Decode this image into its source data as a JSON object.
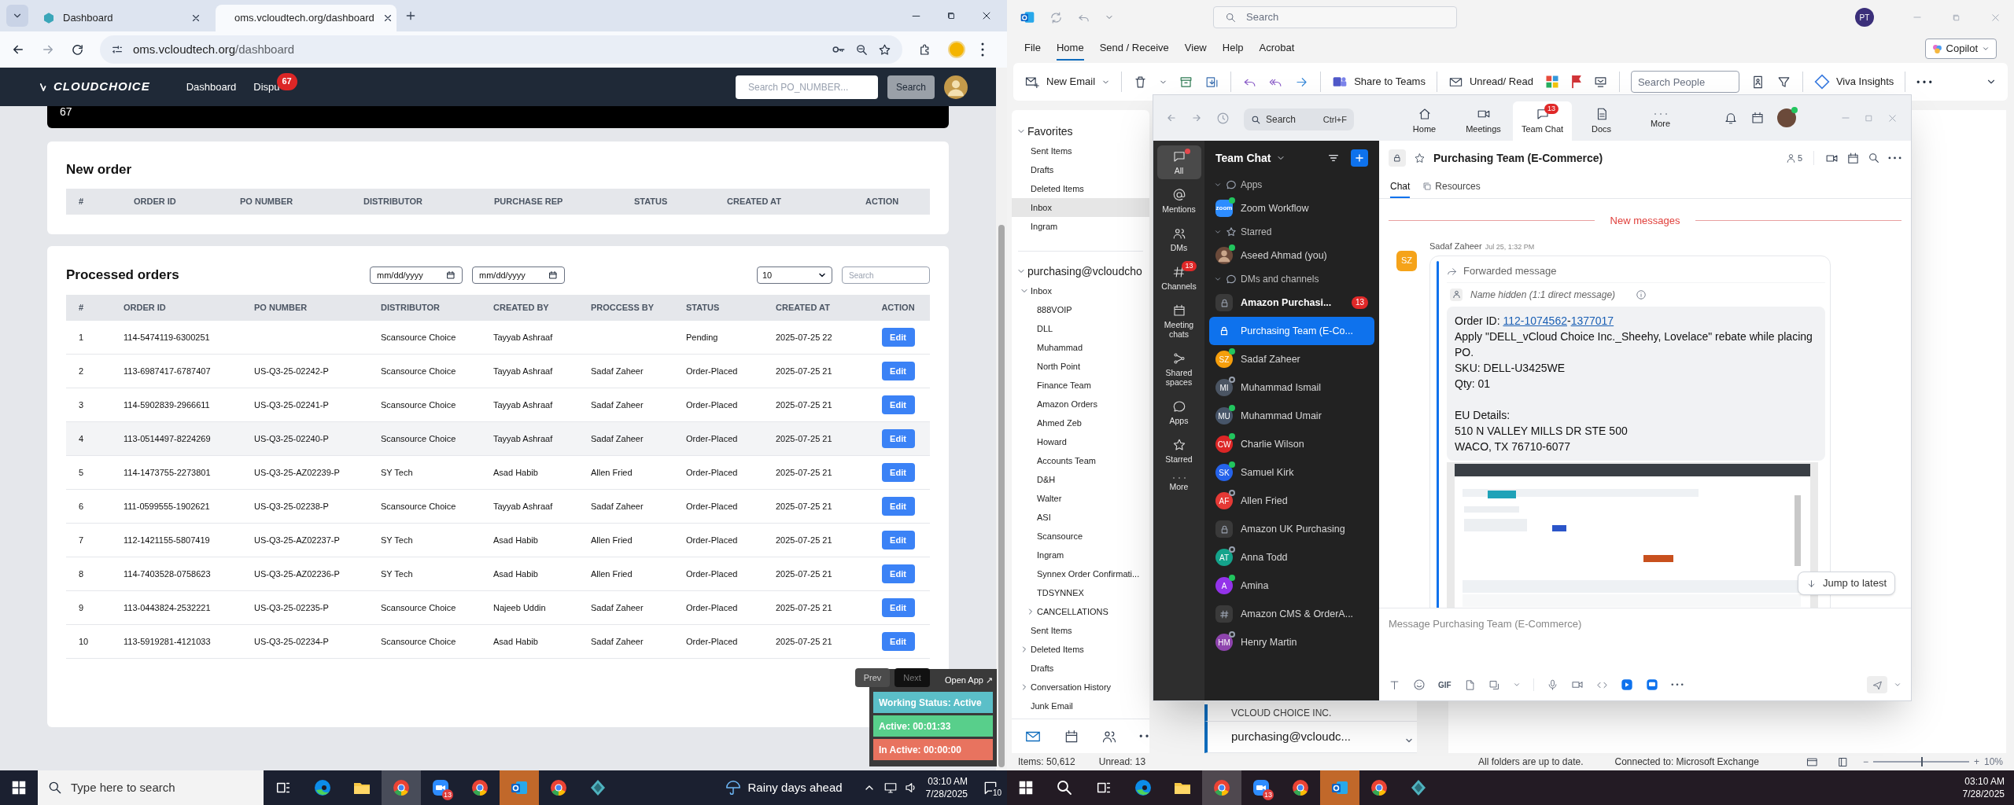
{
  "left_screen": {
    "browser": {
      "tabs": [
        {
          "label": "Dashboard",
          "selected": false
        },
        {
          "label": "oms.vcloudtech.org/dashboard",
          "selected": true
        }
      ],
      "url": {
        "host": "oms.vcloudtech.org",
        "path": "/dashboard"
      }
    },
    "app": {
      "logo": "CLOUDCHOICE",
      "nav": [
        {
          "label": "Dashboard"
        },
        {
          "label": "Dispu",
          "badge": "67"
        }
      ],
      "search": {
        "placeholder": "Search PO_NUMBER..."
      },
      "search_button": "Search",
      "banner_value": "67",
      "new_order": {
        "title": "New order",
        "columns": [
          "#",
          "ORDER ID",
          "PO NUMBER",
          "DISTRIBUTOR",
          "PURCHASE REP",
          "STATUS",
          "CREATED AT",
          "ACTION"
        ]
      },
      "processed_orders": {
        "title": "Processed orders",
        "date_from": {
          "placeholder": "mm/dd/yyyy"
        },
        "date_to": {
          "placeholder": "mm/dd/yyyy"
        },
        "page_size": "10",
        "search": {
          "placeholder": "Search"
        },
        "columns": [
          "#",
          "ORDER ID",
          "PO NUMBER",
          "DISTRIBUTOR",
          "CREATED BY",
          "PROCCESS BY",
          "STATUS",
          "CREATED AT",
          "ACTION"
        ],
        "rows": [
          {
            "num": "1",
            "order_id": "114-5474119-6300251",
            "distributor": "Scansource Choice",
            "created_by": "Tayyab Ashraaf",
            "status": "Pending",
            "created_at": "2025-07-25 22",
            "action": "Edit",
            "highlighted": false
          },
          {
            "num": "2",
            "order_id": "113-6987417-6787407",
            "po_number": "US-Q3-25-02242-P",
            "distributor": "Scansource Choice",
            "created_by": "Tayyab Ashraaf",
            "processed_by": "Sadaf Zaheer",
            "status": "Order-Placed",
            "created_at": "2025-07-25 21",
            "action": "Edit",
            "highlighted": false
          },
          {
            "num": "3",
            "order_id": "114-5902839-2966611",
            "po_number": "US-Q3-25-02241-P",
            "distributor": "Scansource Choice",
            "created_by": "Tayyab Ashraaf",
            "processed_by": "Sadaf Zaheer",
            "status": "Order-Placed",
            "created_at": "2025-07-25 21",
            "action": "Edit",
            "highlighted": false
          },
          {
            "num": "4",
            "order_id": "113-0514497-8224269",
            "po_number": "US-Q3-25-02240-P",
            "distributor": "Scansource Choice",
            "created_by": "Tayyab Ashraaf",
            "processed_by": "Sadaf Zaheer",
            "status": "Order-Placed",
            "created_at": "2025-07-25 21",
            "action": "Edit",
            "highlighted": true
          },
          {
            "num": "5",
            "order_id": "114-1473755-2273801",
            "po_number": "US-Q3-25-AZ02239-P",
            "distributor": "SY Tech",
            "created_by": "Asad Habib",
            "processed_by": "Allen Fried",
            "status": "Order-Placed",
            "created_at": "2025-07-25 21",
            "action": "Edit",
            "highlighted": false
          },
          {
            "num": "6",
            "order_id": "111-0599555-1902621",
            "po_number": "US-Q3-25-02238-P",
            "distributor": "Scansource Choice",
            "created_by": "Tayyab Ashraaf",
            "processed_by": "Sadaf Zaheer",
            "status": "Order-Placed",
            "created_at": "2025-07-25 21",
            "action": "Edit",
            "highlighted": false
          },
          {
            "num": "7",
            "order_id": "112-1421155-5807419",
            "po_number": "US-Q3-25-AZ02237-P",
            "distributor": "SY Tech",
            "created_by": "Asad Habib",
            "processed_by": "Allen Fried",
            "status": "Order-Placed",
            "created_at": "2025-07-25 21",
            "action": "Edit",
            "highlighted": false
          },
          {
            "num": "8",
            "order_id": "114-7403528-0758623",
            "po_number": "US-Q3-25-AZ02236-P",
            "distributor": "SY Tech",
            "created_by": "Asad Habib",
            "processed_by": "Allen Fried",
            "status": "Order-Placed",
            "created_at": "2025-07-25 21",
            "action": "Edit",
            "highlighted": false
          },
          {
            "num": "9",
            "order_id": "113-0443824-2532221",
            "po_number": "US-Q3-25-02235-P",
            "distributor": "Scansource Choice",
            "created_by": "Najeeb Uddin",
            "processed_by": "Sadaf Zaheer",
            "status": "Order-Placed",
            "created_at": "2025-07-25 21",
            "action": "Edit",
            "highlighted": false
          },
          {
            "num": "10",
            "order_id": "113-5919281-4121033",
            "po_number": "US-Q3-25-02234-P",
            "distributor": "Scansource Choice",
            "created_by": "Asad Habib",
            "processed_by": "Sadaf Zaheer",
            "status": "Order-Placed",
            "created_at": "2025-07-25 21",
            "action": "Edit",
            "highlighted": false
          }
        ],
        "pagination": {
          "prev": "Prev",
          "next": "Next"
        }
      }
    },
    "tracker": {
      "open_app": "Open App ↗",
      "lines": [
        {
          "text": "Working Status: Active",
          "color": "#5bbfc8"
        },
        {
          "text": "Active: 00:01:33",
          "color": "#58cf8b"
        },
        {
          "text": "In Active: 00:00:00",
          "color": "#e8735f"
        }
      ]
    },
    "taskbar": {
      "search": {
        "placeholder": "Type here to search"
      },
      "apps": [
        {
          "kind": "task-view",
          "active": false,
          "attention": false
        },
        {
          "kind": "edge",
          "active": false,
          "attention": false
        },
        {
          "kind": "explorer",
          "active": false,
          "attention": false
        },
        {
          "kind": "chrome",
          "active": true,
          "attention": false
        },
        {
          "kind": "zoom",
          "active": false,
          "attention": false,
          "badge": "13"
        },
        {
          "kind": "chrome",
          "active": false,
          "attention": false
        },
        {
          "kind": "outlook",
          "active": false,
          "attention": true
        },
        {
          "kind": "chrome",
          "active": false,
          "attention": false
        },
        {
          "kind": "app",
          "active": false,
          "attention": false
        }
      ],
      "weather": "Rainy days ahead",
      "time": "03:10 AM",
      "date": "7/28/2025",
      "notifications": "10"
    }
  },
  "right_screen": {
    "outlook": {
      "search": {
        "placeholder": "Search"
      },
      "account_initials": "PT",
      "menu": [
        {
          "label": "File",
          "selected": false
        },
        {
          "label": "Home",
          "selected": true
        },
        {
          "label": "Send / Receive",
          "selected": false
        },
        {
          "label": "View",
          "selected": false
        },
        {
          "label": "Help",
          "selected": false
        },
        {
          "label": "Acrobat",
          "selected": false
        }
      ],
      "copilot": "Copilot",
      "ribbon": {
        "new_email": "New Email",
        "share": "Share to Teams",
        "unread": "Unread/ Read",
        "search_people": {
          "placeholder": "Search People"
        },
        "viva": "Viva Insights"
      },
      "folders": [
        {
          "label": "Favorites",
          "expanded": true,
          "selected": false,
          "children": [
            {
              "label": "Sent Items",
              "selected": false
            },
            {
              "label": "Drafts",
              "selected": false
            },
            {
              "label": "Deleted Items",
              "selected": false
            },
            {
              "label": "Inbox",
              "selected": true
            },
            {
              "label": "Ingram",
              "selected": false
            }
          ]
        },
        {
          "label": "purchasing@vcloudcho",
          "expanded": true,
          "selected": false,
          "children": [
            {
              "label": "Inbox",
              "expanded": true,
              "selected": false,
              "children": [
                {
                  "label": "888VOIP",
                  "selected": false
                },
                {
                  "label": "DLL",
                  "selected": false
                },
                {
                  "label": "Muhammad",
                  "selected": false
                },
                {
                  "label": "North Point",
                  "selected": false
                },
                {
                  "label": "Finance Team",
                  "selected": false
                },
                {
                  "label": "Amazon Orders",
                  "selected": false
                },
                {
                  "label": "Ahmed Zeb",
                  "selected": false
                },
                {
                  "label": "Howard",
                  "selected": false
                },
                {
                  "label": "Accounts Team",
                  "selected": false
                },
                {
                  "label": "D&H",
                  "selected": false
                },
                {
                  "label": "Walter",
                  "selected": false
                },
                {
                  "label": "ASI",
                  "selected": false
                },
                {
                  "label": "Scansource",
                  "selected": false
                },
                {
                  "label": "Ingram",
                  "selected": false
                },
                {
                  "label": "Synnex Order Confirmati...",
                  "selected": false
                },
                {
                  "label": "TDSYNNEX",
                  "selected": false
                },
                {
                  "label": "CANCELLATIONS",
                  "expanded": false,
                  "selected": false
                }
              ]
            },
            {
              "label": "Sent Items",
              "selected": false
            },
            {
              "label": "Deleted Items",
              "expanded": false,
              "selected": false
            },
            {
              "label": "Drafts",
              "selected": false
            },
            {
              "label": "Conversation History",
              "expanded": false,
              "selected": false
            },
            {
              "label": "Junk Email",
              "selected": false
            }
          ]
        }
      ],
      "message_list": [
        {
          "text": "VCLOUD CHOICE INC."
        },
        {
          "text": "purchasing@vcloudc..."
        }
      ],
      "status": {
        "items": "Items: 50,612",
        "unread": "Unread: 13",
        "sync": "All folders are up to date.",
        "connection": "Connected to: Microsoft Exchange",
        "zoom_out": "−",
        "zoom_in": "+",
        "zoom": "10%",
        "zoom_slider": {
          "level": 0.5
        }
      }
    },
    "zoom": {
      "search": {
        "placeholder": "Search",
        "shortcut": "Ctrl+F"
      },
      "tabs": [
        {
          "label": "Home",
          "selected": false
        },
        {
          "label": "Meetings",
          "selected": false
        },
        {
          "label": "Team Chat",
          "badge": "13",
          "selected": true
        },
        {
          "label": "Docs",
          "selected": false
        },
        {
          "label": "More",
          "selected": false
        }
      ],
      "rail": [
        {
          "label": "All",
          "selected": true,
          "unread_dot": true
        },
        {
          "label": "Mentions",
          "selected": false,
          "unread_dot": false
        },
        {
          "label": "DMs",
          "selected": false,
          "unread_dot": false
        },
        {
          "label": "Channels",
          "badge": "13",
          "selected": false,
          "unread_dot": false
        },
        {
          "label": "Meeting chats",
          "selected": false,
          "unread_dot": false
        },
        {
          "label": "Shared spaces",
          "selected": false,
          "unread_dot": false
        },
        {
          "label": "Apps",
          "selected": false,
          "unread_dot": false
        },
        {
          "label": "Starred",
          "selected": false,
          "unread_dot": false
        },
        {
          "label": "More",
          "selected": false,
          "unread_dot": false
        }
      ],
      "list_title": "Team Chat",
      "sections": [
        {
          "label": "Apps",
          "expanded": true,
          "items": [
            {
              "kind": "app",
              "label": "Zoom Workflow",
              "icon_label": "zoom",
              "online": true,
              "unread": false,
              "selected": false
            }
          ]
        },
        {
          "label": "Starred",
          "expanded": true,
          "items": [
            {
              "label": "Aseed Ahmad (you)",
              "online": true,
              "unread": false,
              "selected": false
            }
          ]
        },
        {
          "label": "DMs and channels",
          "expanded": true,
          "items": [
            {
              "kind": "private-channel",
              "label": "Amazon Purchasi...",
              "badge": "13",
              "unread": true,
              "selected": false
            },
            {
              "kind": "private-channel",
              "label": "Purchasing Team (E-Co...",
              "unread": false,
              "selected": true
            },
            {
              "kind": "person",
              "label": "Sadaf Zaheer",
              "initials": "SZ",
              "color": "#f59e0b",
              "online": true,
              "unread": false,
              "selected": false
            },
            {
              "kind": "person",
              "label": "Muhammad Ismail",
              "initials": "MI",
              "color": "#4b5563",
              "online": false,
              "unread": false,
              "selected": false
            },
            {
              "kind": "person",
              "label": "Muhammad Umair",
              "initials": "MU",
              "color": "#475569",
              "online": true,
              "unread": false,
              "selected": false
            },
            {
              "kind": "person",
              "label": "Charlie Wilson",
              "initials": "CW",
              "color": "#dc2626",
              "online": true,
              "unread": false,
              "selected": false
            },
            {
              "kind": "person",
              "label": "Samuel Kirk",
              "initials": "SK",
              "color": "#2563eb",
              "online": true,
              "unread": false,
              "selected": false
            },
            {
              "kind": "person",
              "label": "Allen Fried",
              "initials": "AF",
              "color": "#e53935",
              "online": false,
              "unread": false,
              "selected": false
            },
            {
              "kind": "private-channel",
              "label": "Amazon UK Purchasing",
              "unread": false,
              "selected": false
            },
            {
              "kind": "person",
              "label": "Anna Todd",
              "initials": "AT",
              "color": "#14a38b",
              "online": false,
              "unread": false,
              "selected": false
            },
            {
              "kind": "person",
              "label": "Amina",
              "initials": "A",
              "color": "#9333ea",
              "online": true,
              "unread": false,
              "selected": false
            },
            {
              "kind": "channel",
              "label": "Amazon CMS & OrderA...",
              "unread": false,
              "selected": false
            },
            {
              "kind": "person",
              "label": "Henry Martin",
              "initials": "HM",
              "color": "#8e44ad",
              "online": false,
              "unread": false,
              "selected": false
            }
          ]
        }
      ],
      "chat": {
        "title": "Purchasing Team (E-Commerce)",
        "members": "5",
        "tabs": [
          {
            "label": "Chat",
            "selected": true
          },
          {
            "label": "Resources",
            "selected": false
          }
        ],
        "new_messages": "New messages",
        "message": {
          "sender": "Sadaf Zaheer",
          "time": "Jul 25, 1:32 PM",
          "initials": "SZ",
          "forwarded": "Forwarded message",
          "origin": "Name hidden (1:1 direct message)",
          "order_parts": [
            {
              "text": "Order ID: ",
              "link": false
            },
            {
              "text": "112-1074562",
              "link": true
            },
            {
              "text": "-",
              "link": false
            },
            {
              "text": "1377017",
              "link": true
            }
          ],
          "paragraphs": [
            [
              "Apply \"DELL_vCloud Choice Inc._Sheehy, Lovelace\" rebate while placing PO.",
              "SKU: DELL-U3425WE",
              "Qty: 01"
            ],
            [
              "EU Details:",
              "510 N VALLEY MILLS DR STE 500",
              "WACO, TX 76710-6077"
            ]
          ],
          "attachment": {
            "kind": "picture"
          }
        },
        "jump": "Jump to latest",
        "composer": {
          "placeholder": "Message Purchasing Team (E-Commerce)",
          "gif": "GIF"
        }
      }
    },
    "taskbar": {
      "apps": [
        {
          "kind": "task-view",
          "active": false,
          "attention": false
        },
        {
          "kind": "edge",
          "active": false,
          "attention": false
        },
        {
          "kind": "explorer",
          "active": false,
          "attention": false
        },
        {
          "kind": "chrome",
          "active": true,
          "attention": false
        },
        {
          "kind": "zoom",
          "active": false,
          "attention": false,
          "badge": "13"
        },
        {
          "kind": "chrome",
          "active": false,
          "attention": false
        },
        {
          "kind": "outlook",
          "active": false,
          "attention": true
        },
        {
          "kind": "chrome",
          "active": false,
          "attention": false
        },
        {
          "kind": "app",
          "active": false,
          "attention": false
        }
      ],
      "time": "03:10 AM",
      "date": "7/28/2025"
    }
  }
}
